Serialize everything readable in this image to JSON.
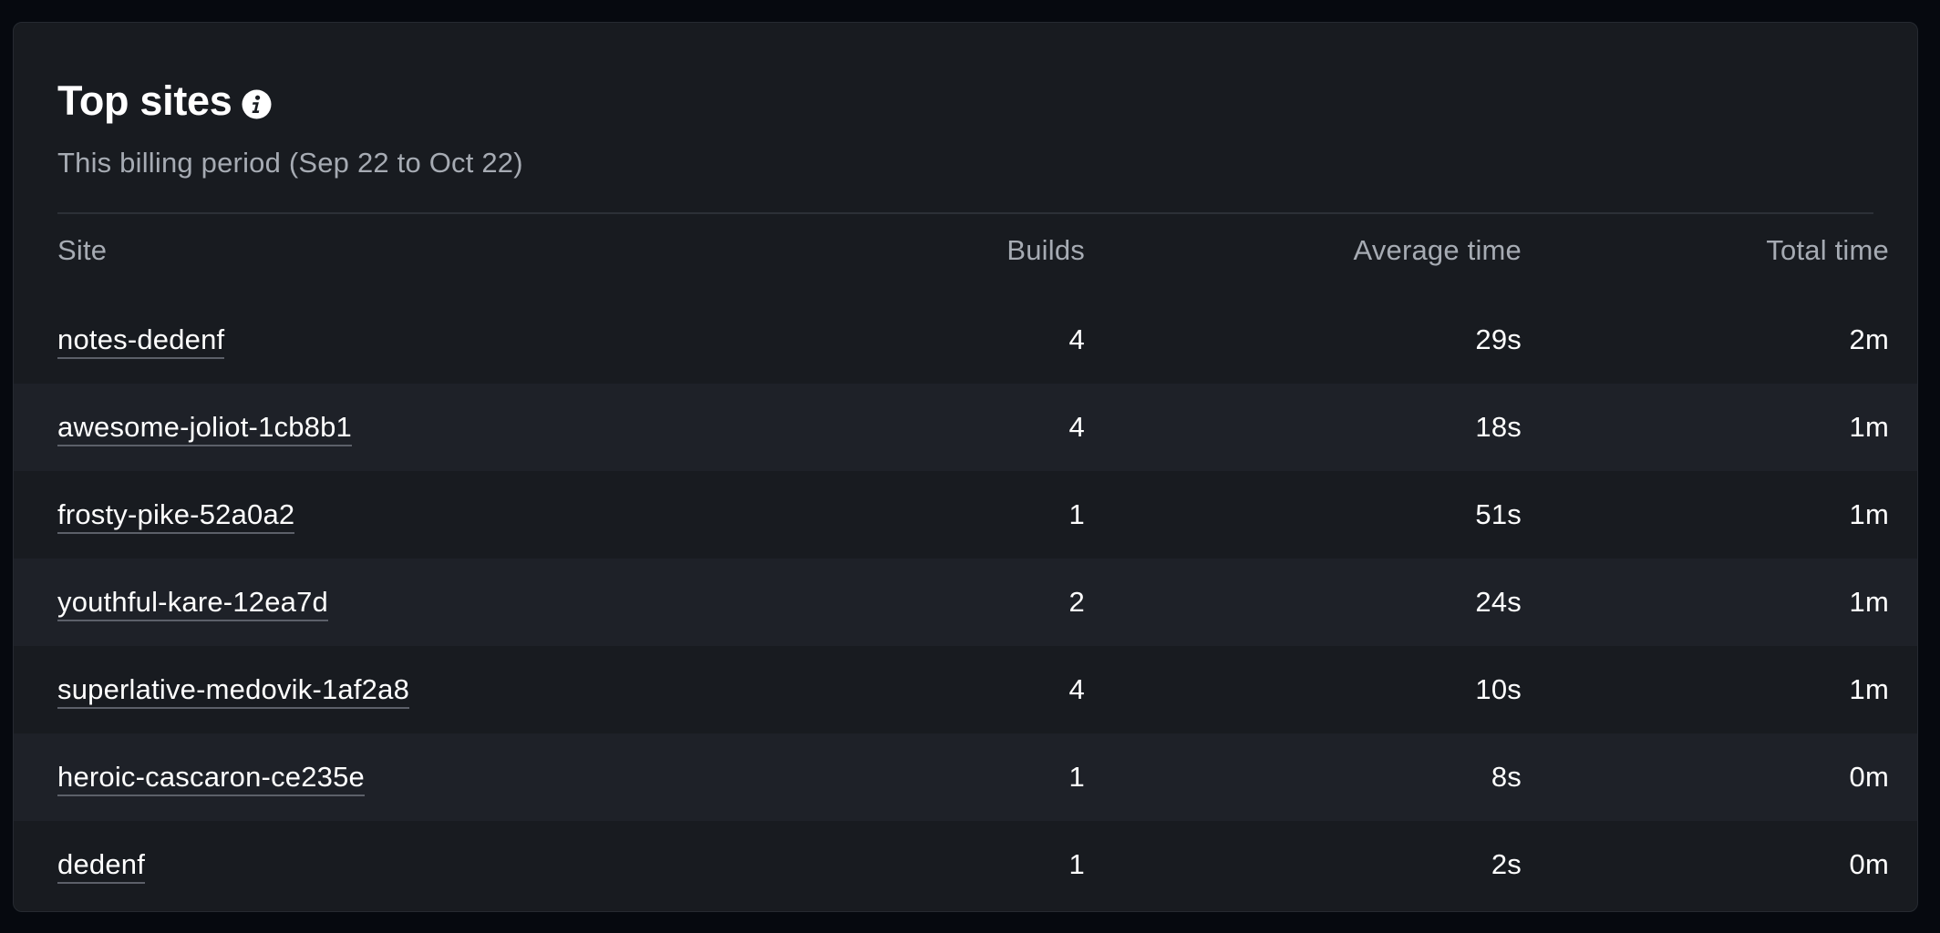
{
  "card": {
    "title": "Top sites",
    "subtitle": "This billing period (Sep 22 to Oct 22)",
    "info_icon": "info-icon"
  },
  "table": {
    "columns": {
      "site": "Site",
      "builds": "Builds",
      "average_time": "Average time",
      "total_time": "Total time"
    },
    "rows": [
      {
        "site": "notes-dedenf",
        "builds": "4",
        "average_time": "29s",
        "total_time": "2m"
      },
      {
        "site": "awesome-joliot-1cb8b1",
        "builds": "4",
        "average_time": "18s",
        "total_time": "1m"
      },
      {
        "site": "frosty-pike-52a0a2",
        "builds": "1",
        "average_time": "51s",
        "total_time": "1m"
      },
      {
        "site": "youthful-kare-12ea7d",
        "builds": "2",
        "average_time": "24s",
        "total_time": "1m"
      },
      {
        "site": "superlative-medovik-1af2a8",
        "builds": "4",
        "average_time": "10s",
        "total_time": "1m"
      },
      {
        "site": "heroic-cascaron-ce235e",
        "builds": "1",
        "average_time": "8s",
        "total_time": "0m"
      },
      {
        "site": "dedenf",
        "builds": "1",
        "average_time": "2s",
        "total_time": "0m"
      }
    ]
  },
  "colors": {
    "page_background": "#06090f",
    "card_background": "#181b20",
    "row_alt_background": "#1e2128",
    "text_primary": "#ffffff",
    "text_secondary": "#a6abb3"
  }
}
